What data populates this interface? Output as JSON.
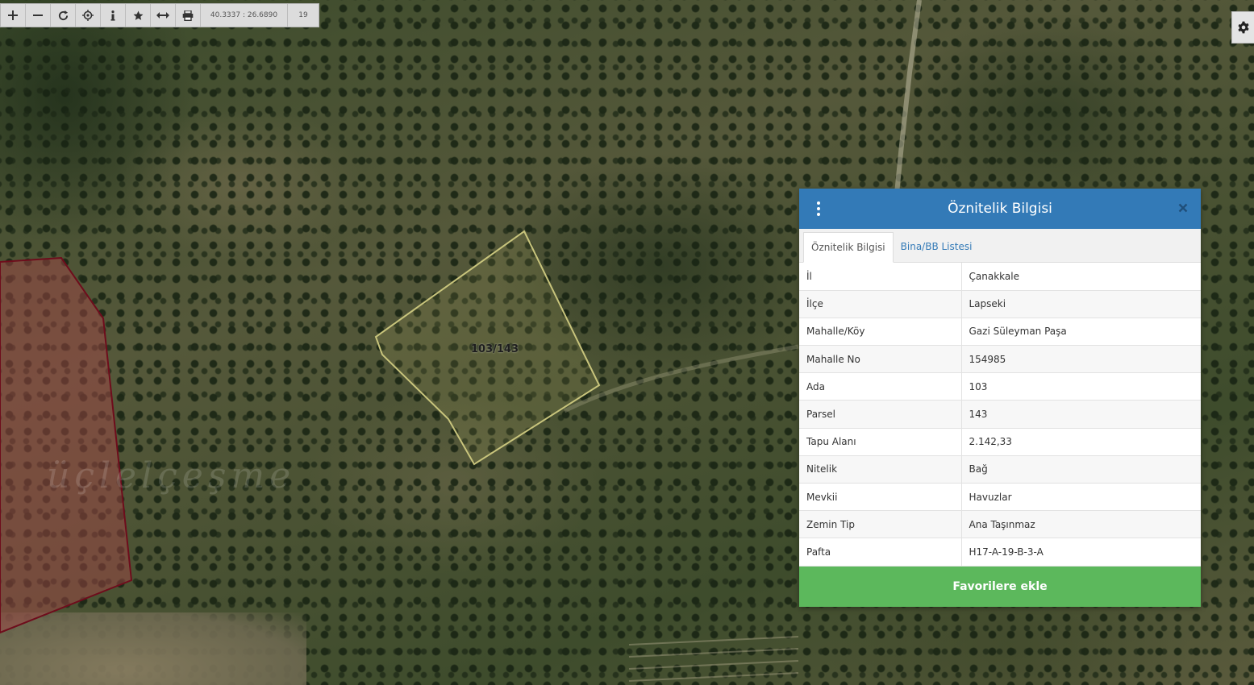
{
  "toolbar": {
    "coordinates": "40.3337 : 26.6890",
    "zoom_level": "19",
    "buttons": [
      "zoom-in-icon",
      "zoom-out-icon",
      "refresh-icon",
      "locate-icon",
      "info-icon",
      "star-icon",
      "measure-icon",
      "print-icon"
    ]
  },
  "map": {
    "parcel_label": "103/143",
    "place_name": "üçlelçeşme",
    "parcel_outline_color": "#c8c47c",
    "neighbor_fill_color": "#8a3a3a",
    "neighbor_outline_color": "#6e0d1c"
  },
  "panel": {
    "title": "Öznitelik Bilgisi",
    "tabs": [
      {
        "label": "Öznitelik Bilgisi",
        "active": true
      },
      {
        "label": "Bina/BB Listesi",
        "active": false
      }
    ],
    "rows": [
      {
        "key": "İl",
        "value": "Çanakkale"
      },
      {
        "key": "İlçe",
        "value": "Lapseki"
      },
      {
        "key": "Mahalle/Köy",
        "value": "Gazi Süleyman Paşa"
      },
      {
        "key": "Mahalle No",
        "value": "154985"
      },
      {
        "key": "Ada",
        "value": "103"
      },
      {
        "key": "Parsel",
        "value": "143"
      },
      {
        "key": "Tapu Alanı",
        "value": "2.142,33"
      },
      {
        "key": "Nitelik",
        "value": "Bağ"
      },
      {
        "key": "Mevkii",
        "value": "Havuzlar"
      },
      {
        "key": "Zemin Tip",
        "value": "Ana Taşınmaz"
      },
      {
        "key": "Pafta",
        "value": "H17-A-19-B-3-A"
      }
    ],
    "favorite_button": "Favorilere ekle",
    "header_color": "#337ab7",
    "button_color": "#5cb85c"
  }
}
